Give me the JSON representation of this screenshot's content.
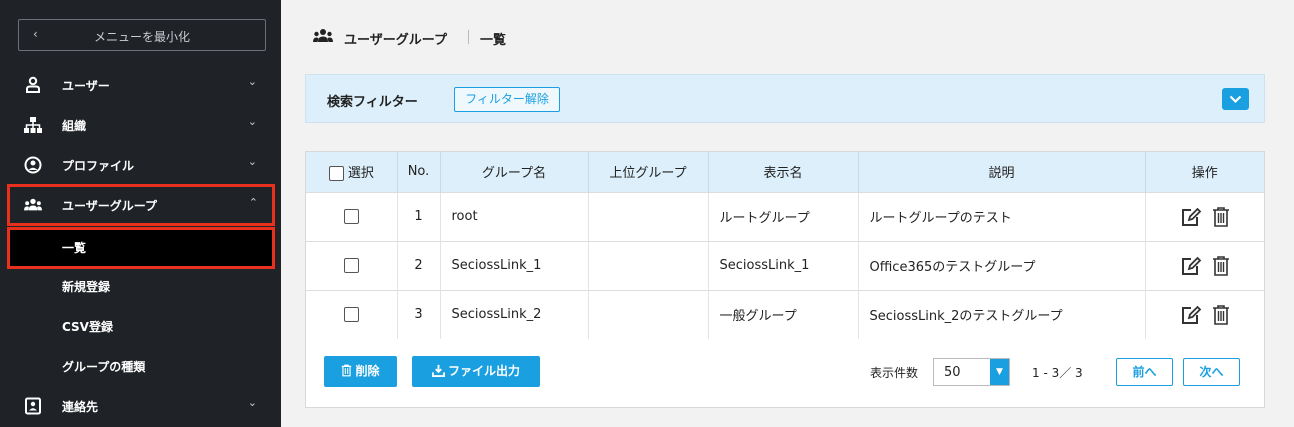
{
  "sidebar": {
    "minimize_label": "メニューを最小化",
    "minimize_chevron": "‹",
    "items": [
      {
        "label": "ユーザー",
        "icon": "user-icon",
        "arrow": "⌄"
      },
      {
        "label": "組織",
        "icon": "org-chart-icon",
        "arrow": "⌄"
      },
      {
        "label": "プロファイル",
        "icon": "profile-icon",
        "arrow": "⌄"
      },
      {
        "label": "ユーザーグループ",
        "icon": "users-group-icon",
        "arrow": "⌃"
      },
      {
        "label": "連絡先",
        "icon": "contact-icon",
        "arrow": "⌄"
      }
    ],
    "sub_items": [
      {
        "label": "一覧"
      },
      {
        "label": "新規登録"
      },
      {
        "label": "CSV登録"
      },
      {
        "label": "グループの種類"
      }
    ]
  },
  "header": {
    "title": "ユーザーグループ",
    "subtitle": "一覧"
  },
  "filter": {
    "label": "検索フィルター",
    "clear_button": "フィルター解除"
  },
  "table": {
    "headers": [
      "選択",
      "No.",
      "グループ名",
      "上位グループ",
      "表示名",
      "説明",
      "操作"
    ],
    "rows": [
      {
        "no": "1",
        "group_name": "root",
        "parent": "",
        "display_name": "ルートグループ",
        "description": "ルートグループのテスト"
      },
      {
        "no": "2",
        "group_name": "SeciossLink_1",
        "parent": "",
        "display_name": "SeciossLink_1",
        "description": "Office365のテストグループ"
      },
      {
        "no": "3",
        "group_name": "SeciossLink_2",
        "parent": "",
        "display_name": "一般グループ",
        "description": "SeciossLink_2のテストグループ"
      }
    ]
  },
  "footer": {
    "delete_button": "削除",
    "export_button": "ファイル出力",
    "page_count_label": "表示件数",
    "page_count_value": "50",
    "range_text": "1 - 3／ 3",
    "prev_button": "前へ",
    "next_button": "次へ"
  },
  "colors": {
    "sidebar_bg": "#1f2328",
    "accent": "#1a9fe0",
    "highlight": "#e8301c",
    "filter_bg": "#dceffa"
  }
}
